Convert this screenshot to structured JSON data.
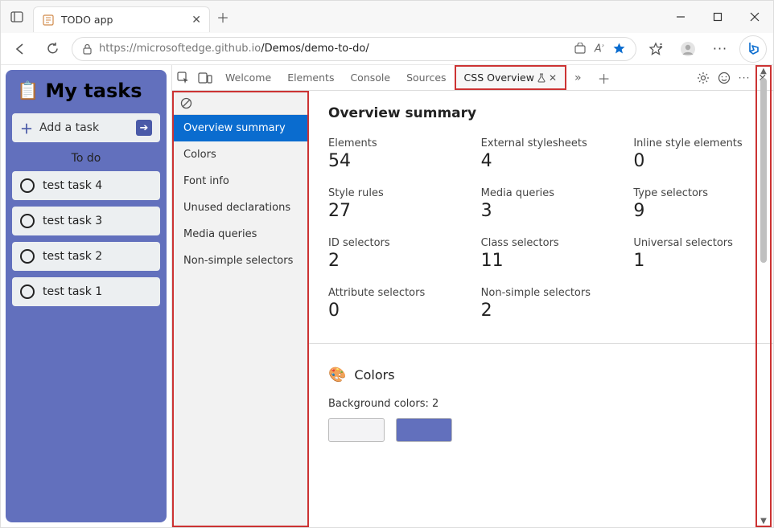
{
  "titlebar": {
    "tab_title": "TODO app"
  },
  "toolbar": {
    "url_host": "https://microsoftedge.github.io",
    "url_path": "/Demos/demo-to-do/"
  },
  "app": {
    "title": "My tasks",
    "add_task_label": "Add a task",
    "todo_label": "To do",
    "tasks": [
      "test task 4",
      "test task 3",
      "test task 2",
      "test task 1"
    ]
  },
  "devtools": {
    "tabs": {
      "welcome": "Welcome",
      "elements": "Elements",
      "console": "Console",
      "sources": "Sources",
      "css_overview": "CSS Overview"
    },
    "nav": {
      "overview_summary": "Overview summary",
      "colors": "Colors",
      "font_info": "Font info",
      "unused_declarations": "Unused declarations",
      "media_queries": "Media queries",
      "non_simple_selectors": "Non-simple selectors"
    },
    "main": {
      "heading": "Overview summary",
      "stats": [
        {
          "label": "Elements",
          "value": "54"
        },
        {
          "label": "External stylesheets",
          "value": "4"
        },
        {
          "label": "Inline style elements",
          "value": "0"
        },
        {
          "label": "Style rules",
          "value": "27"
        },
        {
          "label": "Media queries",
          "value": "3"
        },
        {
          "label": "Type selectors",
          "value": "9"
        },
        {
          "label": "ID selectors",
          "value": "2"
        },
        {
          "label": "Class selectors",
          "value": "11"
        },
        {
          "label": "Universal selectors",
          "value": "1"
        },
        {
          "label": "Attribute selectors",
          "value": "0"
        },
        {
          "label": "Non-simple selectors",
          "value": "2"
        }
      ],
      "colors_heading": "Colors",
      "bg_colors_label": "Background colors: 2",
      "bg_swatches": [
        "#f3f3f5",
        "#6270bd"
      ]
    }
  }
}
